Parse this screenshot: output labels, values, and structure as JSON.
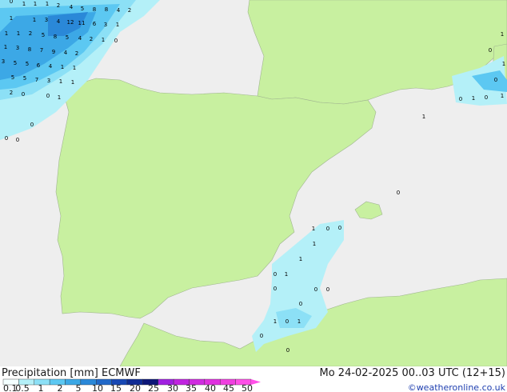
{
  "title_left": "Precipitation [mm] ECMWF",
  "title_right": "Mo 24-02-2025 00..03 UTC (12+15)",
  "credit": "©weatheronline.co.uk",
  "colors": {
    "sea": "#eeeeee",
    "land": "#c8f0a0",
    "border": "#8fa08a",
    "precip_scale": [
      "#f4ffff",
      "#b4f0f8",
      "#8ce0f6",
      "#5cc8f2",
      "#3ca8e6",
      "#2a88d8",
      "#2068c8",
      "#1848b4",
      "#102c94",
      "#0c1678",
      "#a020e0",
      "#c024e0",
      "#d02ce0",
      "#e030e0",
      "#f040e0",
      "#ff50e8"
    ]
  },
  "legend": {
    "labels": [
      "0.1",
      "0.5",
      "1",
      "2",
      "5",
      "10",
      "15",
      "20",
      "25",
      "30",
      "35",
      "40",
      "45",
      "50"
    ]
  },
  "grid_values": [
    {
      "id": "v1",
      "text": "0"
    },
    {
      "id": "v2",
      "text": "1"
    },
    {
      "id": "v3",
      "text": "1"
    },
    {
      "id": "v4",
      "text": "1"
    },
    {
      "id": "v5",
      "text": "2"
    },
    {
      "id": "v6",
      "text": "4"
    },
    {
      "id": "v7",
      "text": "5"
    },
    {
      "id": "v8",
      "text": "8"
    },
    {
      "id": "v9",
      "text": "8"
    },
    {
      "id": "v10",
      "text": "4"
    },
    {
      "id": "v11",
      "text": "2"
    },
    {
      "id": "v12",
      "text": "1"
    },
    {
      "id": "v13",
      "text": "1"
    },
    {
      "id": "v14",
      "text": "3"
    },
    {
      "id": "v15",
      "text": "4"
    },
    {
      "id": "v16",
      "text": "12"
    },
    {
      "id": "v17",
      "text": "11"
    },
    {
      "id": "v18",
      "text": "6"
    },
    {
      "id": "v19",
      "text": "3"
    },
    {
      "id": "v20",
      "text": "1"
    },
    {
      "id": "v21",
      "text": "1"
    },
    {
      "id": "v22",
      "text": "1"
    },
    {
      "id": "v23",
      "text": "2"
    },
    {
      "id": "v24",
      "text": "5"
    },
    {
      "id": "v25",
      "text": "8"
    },
    {
      "id": "v26",
      "text": "5"
    },
    {
      "id": "v27",
      "text": "4"
    },
    {
      "id": "v28",
      "text": "2"
    },
    {
      "id": "v29",
      "text": "1"
    },
    {
      "id": "v30",
      "text": "0"
    },
    {
      "id": "v31",
      "text": "1"
    },
    {
      "id": "v32",
      "text": "3"
    },
    {
      "id": "v33",
      "text": "8"
    },
    {
      "id": "v34",
      "text": "7"
    },
    {
      "id": "v35",
      "text": "9"
    },
    {
      "id": "v36",
      "text": "4"
    },
    {
      "id": "v37",
      "text": "2"
    },
    {
      "id": "v38",
      "text": "3"
    },
    {
      "id": "v39",
      "text": "5"
    },
    {
      "id": "v40",
      "text": "5"
    },
    {
      "id": "v41",
      "text": "6"
    },
    {
      "id": "v42",
      "text": "4"
    },
    {
      "id": "v43",
      "text": "1"
    },
    {
      "id": "v44",
      "text": "1"
    },
    {
      "id": "v45",
      "text": "5"
    },
    {
      "id": "v46",
      "text": "5"
    },
    {
      "id": "v47",
      "text": "7"
    },
    {
      "id": "v48",
      "text": "3"
    },
    {
      "id": "v49",
      "text": "1"
    },
    {
      "id": "v50",
      "text": "1"
    },
    {
      "id": "v51",
      "text": "2"
    },
    {
      "id": "v52",
      "text": "0"
    },
    {
      "id": "v53",
      "text": "0"
    },
    {
      "id": "v54",
      "text": "1"
    },
    {
      "id": "v55",
      "text": "0"
    },
    {
      "id": "v56",
      "text": "0"
    },
    {
      "id": "v57",
      "text": "0"
    },
    {
      "id": "v58",
      "text": "1"
    },
    {
      "id": "v59",
      "text": "0"
    },
    {
      "id": "v60",
      "text": "1"
    },
    {
      "id": "v61",
      "text": "0"
    },
    {
      "id": "v62",
      "text": "1"
    },
    {
      "id": "v63",
      "text": "0"
    },
    {
      "id": "v64",
      "text": "1"
    },
    {
      "id": "v65",
      "text": "0"
    },
    {
      "id": "v66",
      "text": "1"
    },
    {
      "id": "v67",
      "text": "0"
    },
    {
      "id": "v68",
      "text": "1"
    },
    {
      "id": "v69",
      "text": "0"
    },
    {
      "id": "v70",
      "text": "0"
    },
    {
      "id": "v71",
      "text": "1"
    },
    {
      "id": "v72",
      "text": "1"
    },
    {
      "id": "v73",
      "text": "0"
    },
    {
      "id": "v74",
      "text": "1"
    },
    {
      "id": "v75",
      "text": "0"
    },
    {
      "id": "v76",
      "text": "0"
    },
    {
      "id": "v77",
      "text": "0"
    },
    {
      "id": "v78",
      "text": "1"
    },
    {
      "id": "v79",
      "text": "0"
    },
    {
      "id": "v80",
      "text": "1"
    },
    {
      "id": "v81",
      "text": "0"
    },
    {
      "id": "v82",
      "text": "0"
    },
    {
      "id": "v83",
      "text": "0"
    }
  ]
}
